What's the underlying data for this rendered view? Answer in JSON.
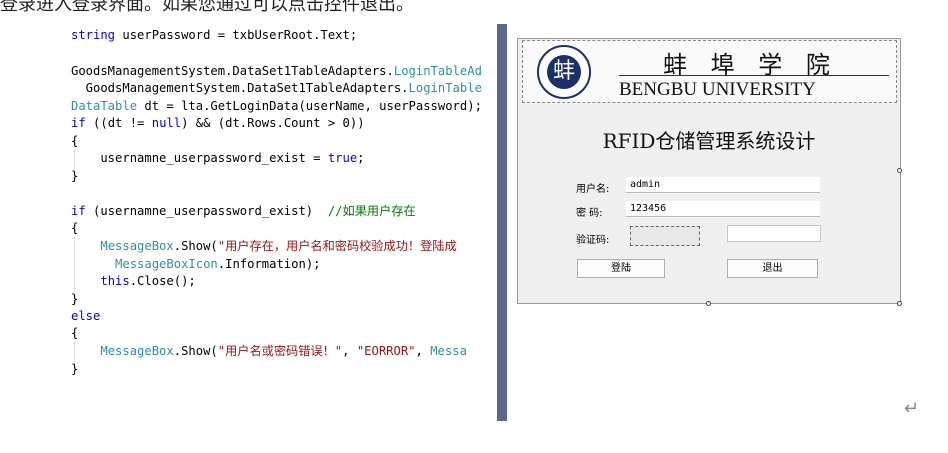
{
  "document": {
    "top_text": "登录进入登录界面。如果您通过可以点击控件退出。"
  },
  "code": {
    "lines": [
      "string userPassword = txbUserRoot.Text;",
      "",
      "GoodsManagementSystem.DataSet1TableAdapters.LoginTableAd",
      "  GoodsManagementSystem.DataSet1TableAdapters.LoginTable",
      "DataTable dt = lta.GetLoginData(userName, userPassword);",
      "if ((dt != null) && (dt.Rows.Count > 0))",
      "{",
      "    usernamne_userpassword_exist = true;",
      "}",
      "",
      "if (usernamne_userpassword_exist)  //如果用户存在",
      "{",
      "    MessageBox.Show(\"用户存在，用户名和密码校验成功！登陆成",
      "      MessageBoxIcon.Information);",
      "    this.Close();",
      "}",
      "else",
      "{",
      "    MessageBox.Show(\"用户名或密码错误！\", \"EORROR\", Messa",
      "}"
    ]
  },
  "form": {
    "school_name_cn": "蚌 埠 学 院",
    "school_name_en": "BENGBU UNIVERSITY",
    "emblem_glyph": "蚌",
    "title": "RFID仓储管理系统设计",
    "username_label": "用户名:",
    "username_value": "admin",
    "password_label": "密  码:",
    "password_value": "123456",
    "captcha_label": "验证码:",
    "captcha_input_value": "",
    "login_button": "登陆",
    "exit_button": "退出"
  },
  "colors": {
    "keyword": "#0000ff",
    "type": "#2b91af",
    "string": "#a31515",
    "comment": "#008000",
    "splitter": "#5b6a8c",
    "form_bg": "#f0f0f0"
  },
  "icons": {
    "paragraph_mark": "return-arrow-icon"
  }
}
